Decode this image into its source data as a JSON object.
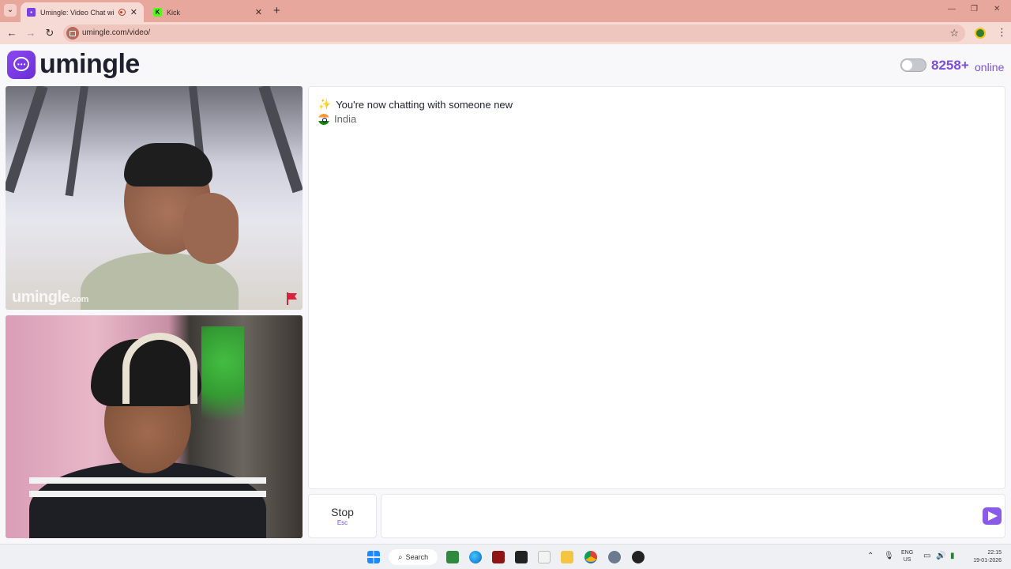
{
  "browser": {
    "tabs": [
      {
        "title": "Umingle: Video Chat with S",
        "active": true
      },
      {
        "title": "Kick",
        "active": false
      }
    ],
    "new_tab_glyph": "+",
    "url": "umingle.com/video/"
  },
  "site": {
    "logo_text": "umingle",
    "online_count": "8258+",
    "online_label": "online"
  },
  "videos": {
    "watermark_text": "umingle",
    "watermark_suffix": ".com"
  },
  "chat": {
    "system_message": "You're now chatting with someone new",
    "country": "India",
    "stop_label": "Stop",
    "stop_shortcut": "Esc",
    "input_value": "",
    "input_placeholder": ""
  },
  "taskbar": {
    "search_label": "Search",
    "lang_line1": "ENG",
    "lang_line2": "US",
    "time": "22:15",
    "date": "19-01-2026"
  },
  "colors": {
    "brand": "#7b4ee0",
    "tabbar": "#e8a79c",
    "report": "#d8223c"
  }
}
